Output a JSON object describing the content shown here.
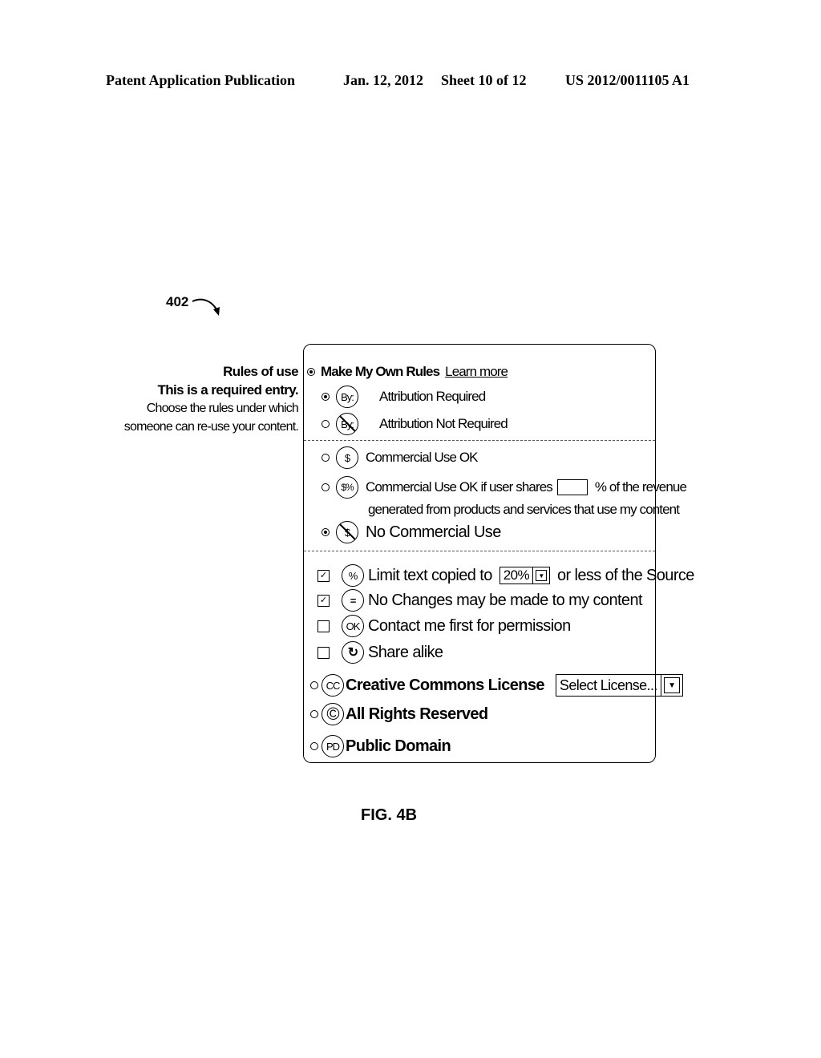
{
  "header": {
    "publication": "Patent Application Publication",
    "date": "Jan. 12, 2012",
    "sheet": "Sheet 10 of 12",
    "number": "US 2012/0011105 A1"
  },
  "reference_label": "402",
  "sidebar": {
    "title": "Rules of use",
    "required": "This is a required entry.",
    "desc_line1": "Choose the rules under which",
    "desc_line2": "someone  can re-use your content."
  },
  "section_own_rules": {
    "label": "Make My Own Rules",
    "selected": true,
    "learn_more": "Learn more",
    "attribution": [
      {
        "icon": "by-icon",
        "badge": "By:",
        "label": "Attribution Required",
        "selected": true
      },
      {
        "icon": "by-not-icon",
        "badge": "By:",
        "label": "Attribution Not Required",
        "selected": false
      }
    ]
  },
  "section_commercial": {
    "options": [
      {
        "icon": "dollar-icon",
        "badge": "$",
        "label": "Commercial Use OK",
        "selected": false
      },
      {
        "icon": "dollar-percent-icon",
        "badge": "$%",
        "label_before": "Commercial Use OK if user shares",
        "input_value": "",
        "label_after": "% of the revenue",
        "label_line2": "generated from products and services that use my content",
        "selected": false
      },
      {
        "icon": "no-dollar-icon",
        "badge": "$",
        "label": "No Commercial Use",
        "selected": true
      }
    ]
  },
  "section_restrictions": {
    "items": [
      {
        "icon": "percent-icon",
        "badge": "%",
        "label_before": "Limit text copied to",
        "select_value": "20%",
        "label_after": "or less of the Source",
        "checked": true
      },
      {
        "icon": "equals-icon",
        "badge": "=",
        "label": "No Changes may be made to my content",
        "checked": true
      },
      {
        "icon": "ok-icon",
        "badge": "OK",
        "label": "Contact me first for permission",
        "checked": false
      },
      {
        "icon": "share-alike-icon",
        "badge": "↻",
        "label": "Share alike",
        "checked": false
      }
    ]
  },
  "licenses": [
    {
      "icon": "cc-icon",
      "badge": "CC",
      "label": "Creative Commons License",
      "select_placeholder": "Select License...",
      "selected": false
    },
    {
      "icon": "copyright-icon",
      "badge": "©",
      "label": "All Rights Reserved",
      "selected": false
    },
    {
      "icon": "pd-icon",
      "badge": "PD",
      "label": "Public Domain",
      "selected": false
    }
  ],
  "figure_label": "FIG. 4B"
}
